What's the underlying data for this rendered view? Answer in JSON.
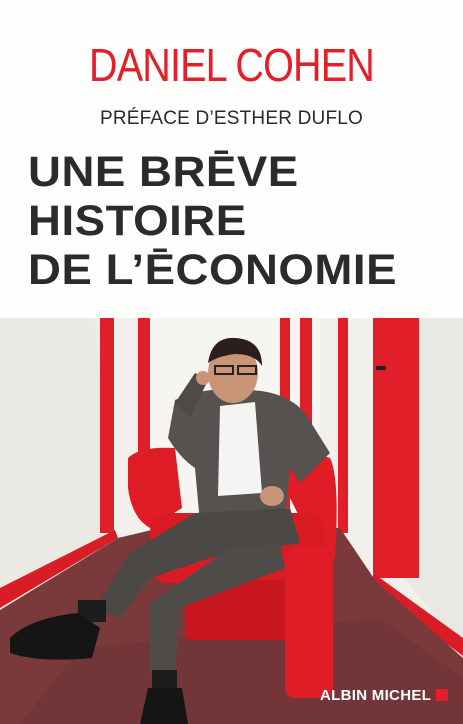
{
  "cover": {
    "author": "DANIEL COHEN",
    "preface": "PRÉFACE D’ESTHER DUFLO",
    "title_lines": [
      "UNE BRĒVE",
      "HISTOIRE",
      "DE L’ĒCONOMIE"
    ],
    "publisher": "ALBIN MICHEL"
  },
  "colors": {
    "accent_red": "#e3202a",
    "title_dark": "#2b2b2b",
    "background": "#fdfdfb",
    "carpet": "#7a3a3c"
  },
  "photo": {
    "description_icon": "man-in-red-armchair-photo"
  }
}
